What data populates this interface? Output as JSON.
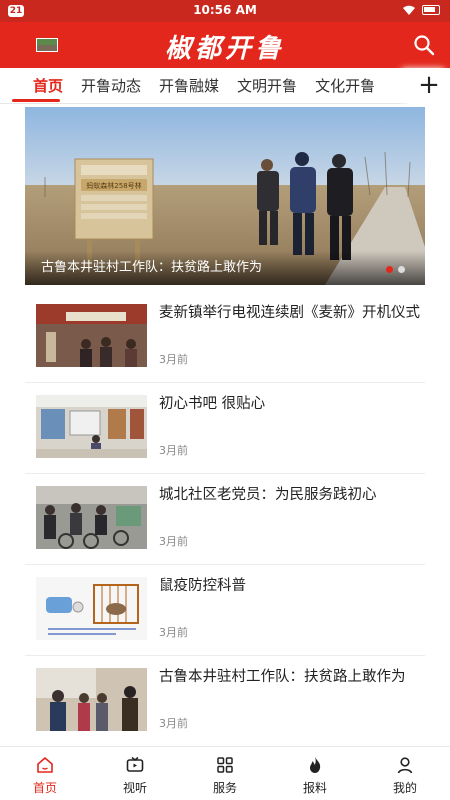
{
  "status_bar": {
    "notification_count": "21",
    "time": "10:56 AM",
    "icons": [
      "wifi-icon",
      "battery-icon"
    ]
  },
  "header": {
    "title": "椒都开鲁",
    "left_icon": "app-logo-badge",
    "right_icon": "search-icon"
  },
  "tabs": [
    {
      "label": "首页",
      "active": true
    },
    {
      "label": "开鲁动态",
      "active": false
    },
    {
      "label": "开鲁融媒",
      "active": false
    },
    {
      "label": "文明开鲁",
      "active": false
    },
    {
      "label": "文化开鲁",
      "active": false
    }
  ],
  "tab_add_label": "+",
  "banner": {
    "caption": "古鲁本井驻村工作队：扶贫路上敢作为",
    "sign_text": "蚂蚁森林258号林",
    "slide_count": 2,
    "active_slide": 1
  },
  "news": [
    {
      "title": "麦新镇举行电视连续剧《麦新》开机仪式",
      "time": "3月前",
      "thumb": "ceremony-photo"
    },
    {
      "title": "初心书吧 很贴心",
      "time": "3月前",
      "thumb": "reading-room-photo"
    },
    {
      "title": "城北社区老党员：为民服务践初心",
      "time": "3月前",
      "thumb": "community-bikes-photo"
    },
    {
      "title": "鼠疫防控科普",
      "time": "3月前",
      "thumb": "rodent-cage-illustration"
    },
    {
      "title": "古鲁本井驻村工作队：扶贫路上敢作为",
      "time": "3月前",
      "thumb": "village-visit-photo"
    }
  ],
  "bottom_nav": [
    {
      "label": "首页",
      "icon": "home-icon",
      "active": true
    },
    {
      "label": "视听",
      "icon": "tv-icon",
      "active": false
    },
    {
      "label": "服务",
      "icon": "grid-icon",
      "active": false
    },
    {
      "label": "报料",
      "icon": "flame-icon",
      "active": false
    },
    {
      "label": "我的",
      "icon": "user-icon",
      "active": false
    }
  ],
  "colors": {
    "brand_red": "#e3271c",
    "status_red": "#c8281e",
    "text": "#222222",
    "muted": "#888888"
  }
}
